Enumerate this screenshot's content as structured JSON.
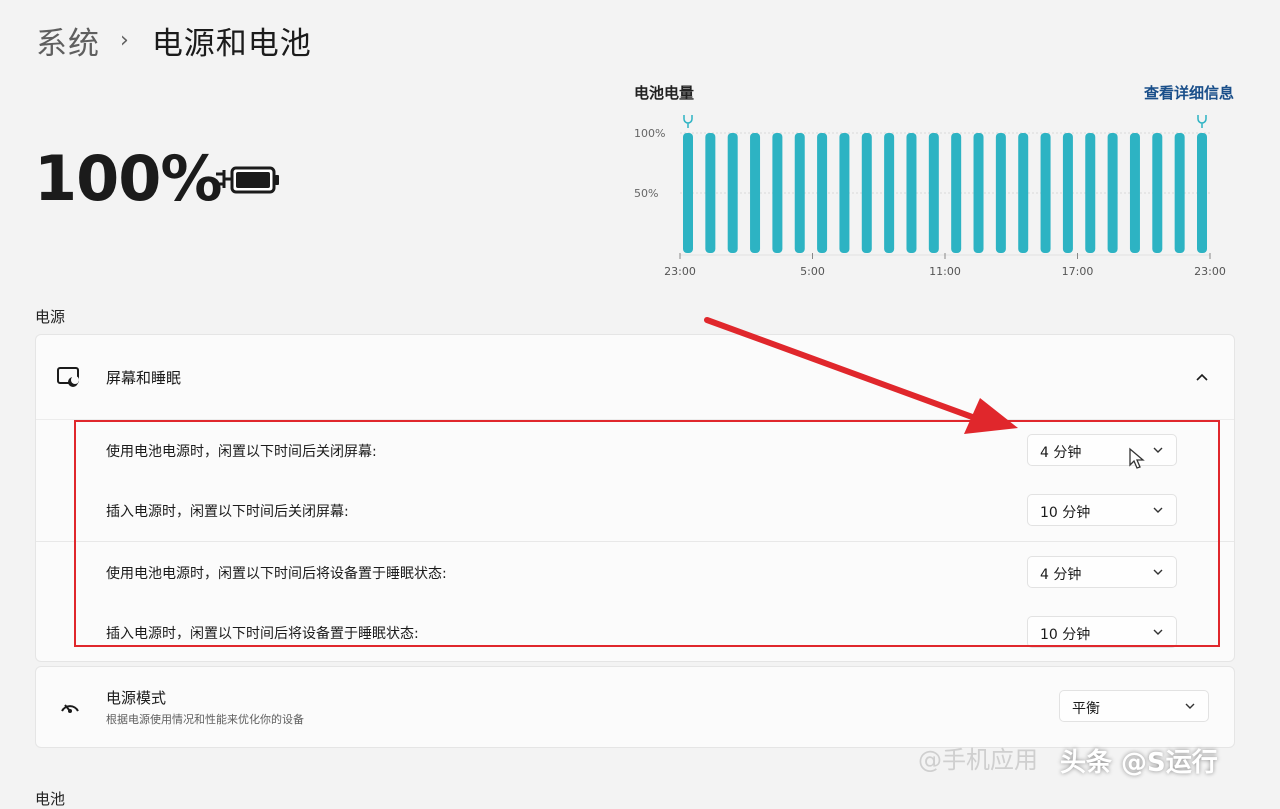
{
  "breadcrumb": {
    "parent": "系统",
    "separator": "›",
    "current": "电源和电池"
  },
  "battery": {
    "percent_text": "100%"
  },
  "chart_data": {
    "type": "bar",
    "title": "电池电量",
    "link": "查看详细信息",
    "y_ticks": [
      "100%",
      "50%"
    ],
    "x_ticks": [
      "23:00",
      "5:00",
      "11:00",
      "17:00",
      "23:00"
    ],
    "ylim": [
      0,
      100
    ],
    "values": [
      100,
      100,
      100,
      100,
      100,
      100,
      100,
      100,
      100,
      100,
      100,
      100,
      100,
      100,
      100,
      100,
      100,
      100,
      100,
      100,
      100,
      100,
      100,
      100
    ],
    "plug_markers": [
      0,
      23
    ],
    "bar_color": "#2db3c3",
    "grid": true
  },
  "power": {
    "section_label": "电源",
    "sleep": {
      "title": "屏幕和睡眠",
      "rows": [
        {
          "label": "使用电池电源时，闲置以下时间后关闭屏幕:",
          "value": "4 分钟"
        },
        {
          "label": "插入电源时，闲置以下时间后关闭屏幕:",
          "value": "10 分钟"
        },
        {
          "label": "使用电池电源时，闲置以下时间后将设备置于睡眠状态:",
          "value": "4 分钟"
        },
        {
          "label": "插入电源时，闲置以下时间后将设备置于睡眠状态:",
          "value": "10 分钟"
        }
      ]
    },
    "mode": {
      "title": "电源模式",
      "description": "根据电源使用情况和性能来优化你的设备",
      "value": "平衡"
    }
  },
  "next_section_label": "电池",
  "watermark": {
    "faint": "@手机应用",
    "main": "头条 @S运行"
  },
  "colors": {
    "highlight": "#e0272c",
    "accent_link": "#1a4f8a"
  }
}
